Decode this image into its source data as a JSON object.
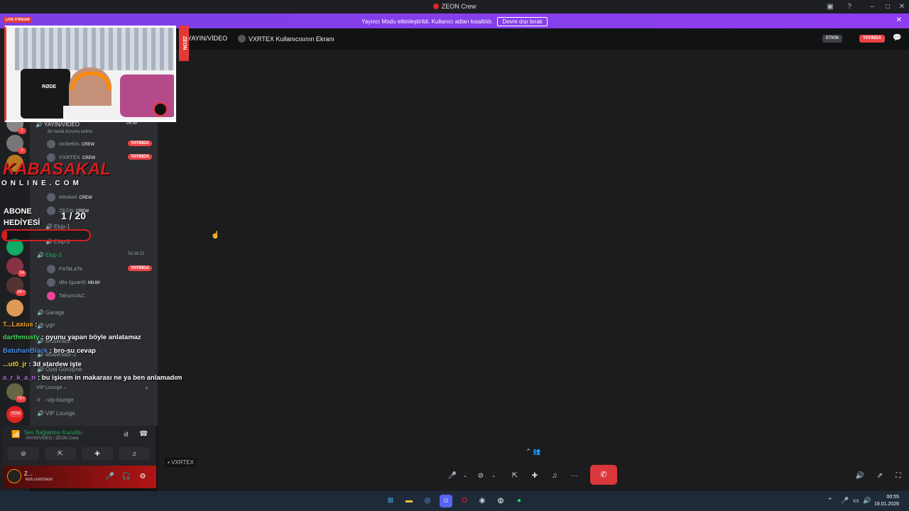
{
  "window": {
    "title": "ZEON Crew"
  },
  "banner": {
    "message": "Yayıncı Modu etkinleştirildi. Kullanıcı adları kısaltıldı.",
    "button": "Devre dışı bırak"
  },
  "stage_header": {
    "channel": "YAYIN/VİDEO",
    "screen_label": "VXRTEX Kullanıcısının Ekranı",
    "pill_active": "ETKİN",
    "pill_live": "YAYINDA"
  },
  "sidebar": {
    "channel_yayin": {
      "name": "YAYIN/VİDEO",
      "time": "26:39",
      "status_hint": "Bir kanal durumu belirle"
    },
    "members_yayin": [
      {
        "name": "cicibebis",
        "tag": "CREW",
        "live": "YAYINDA"
      },
      {
        "name": "VXRTEX",
        "tag": "CREW",
        "live": "YAYINDA"
      },
      {
        "name": "MetAnıl",
        "tag": "CREW"
      },
      {
        "name": "ZEON",
        "tag": "CREW"
      }
    ],
    "channels": [
      {
        "name": "Ekip-1"
      },
      {
        "name": "Ekip-2"
      },
      {
        "name": "Ekip-3",
        "time": "54:38:21"
      }
    ],
    "members_ekip3": [
      {
        "name": "FaTaLaTa",
        "live": "YAYINDA"
      },
      {
        "name": "dila (guard)",
        "tag": "MIUW"
      },
      {
        "name": "TahsinVAC"
      }
    ],
    "more_channels": [
      {
        "name": "Garage"
      },
      {
        "name": "VIP"
      },
      {
        "name": "Moderator"
      },
      {
        "name": "Moderator-2"
      },
      {
        "name": "Özel Görüşme"
      }
    ],
    "category_vip": "VIP Lounge",
    "vip_channels": [
      {
        "name": "-vip-lounge"
      },
      {
        "name": "VIP Lounge"
      }
    ],
    "server_badges": [
      "1",
      "1",
      "34",
      "3K+",
      "7K+",
      "YENİ"
    ]
  },
  "voice_panel": {
    "status": "Ses Bağlantısı Kuruldu",
    "sub": "YAYIN/VİDEO / ZEON Crew"
  },
  "user_panel": {
    "name": "Z...",
    "status": "kick.com/zeon"
  },
  "stage": {
    "name_tag": "VXRTEX"
  },
  "overlay": {
    "brand": "KABASAKAL",
    "brand_sub": "ONLINE.COM",
    "sub_goal_label": "ABONE HEDİYESİ",
    "sub_goal_count": "1 / 20",
    "sub_goal_progress": 0.05,
    "live_tag": "LIVE STREAM",
    "vertical_brand": "ZEON"
  },
  "chat": [
    {
      "user": "T...Laxius",
      "text": ":",
      "color": "#f5a623"
    },
    {
      "user": "darthmusty",
      "text": ": oyunu yapan böyle anlatamaz",
      "color": "#4cd964"
    },
    {
      "user": "BatuhanBlack",
      "text": ": bro-su cevap",
      "color": "#4a90e2"
    },
    {
      "user": "...ut0_jr",
      "text": ": 3d stardew işte",
      "color": "#f5d623"
    },
    {
      "user": "a_r_k_a_n",
      "text": ": bu işicem in makarası ne ya ben anlamadım",
      "color": "#b16ae8"
    }
  ],
  "taskbar": {
    "time": "00:55",
    "date": "19.01.2026"
  },
  "colors": {
    "accent": "#8f3df0",
    "live": "#ed4245",
    "voice_ok": "#23a55a",
    "end_call": "#da373c"
  }
}
